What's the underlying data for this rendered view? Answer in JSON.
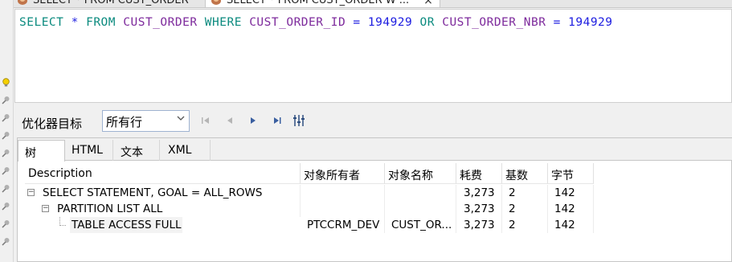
{
  "editor_tabs": [
    {
      "label": "SELECT * FROM CUST_ORDER"
    },
    {
      "label": "SELECT * FROM CUST_ORDER W ...",
      "close": "×"
    }
  ],
  "sql": {
    "select": "SELECT",
    "star": "*",
    "from": "FROM",
    "table": "CUST_ORDER",
    "where": "WHERE",
    "col1": "CUST_ORDER_ID",
    "eq1": "=",
    "val1": "194929",
    "or": "OR",
    "col2": "CUST_ORDER_NBR",
    "eq2": "=",
    "val2": "194929"
  },
  "toolbar": {
    "goal_label": "优化器目标",
    "goal_value": "所有行"
  },
  "result_tabs": [
    "树",
    "HTML",
    "文本",
    "XML"
  ],
  "table": {
    "columns": [
      "Description",
      "对象所有者",
      "对象名称",
      "耗费",
      "基数",
      "字节"
    ],
    "rows": [
      {
        "description": "SELECT STATEMENT, GOAL = ALL_ROWS",
        "owner": "",
        "name": "",
        "cost": "3,273",
        "cardinality": "2",
        "bytes": "142"
      },
      {
        "description": "PARTITION LIST ALL",
        "owner": "",
        "name": "",
        "cost": "3,273",
        "cardinality": "2",
        "bytes": "142"
      },
      {
        "description": "TABLE ACCESS FULL",
        "owner": "PTCCRM_DEV",
        "name": "CUST_OR...",
        "cost": "3,273",
        "cardinality": "2",
        "bytes": "142"
      }
    ]
  },
  "colors": {
    "keyword": "#0a8a7e",
    "identifier": "#7d2a9c",
    "number": "#1c1ce0"
  }
}
